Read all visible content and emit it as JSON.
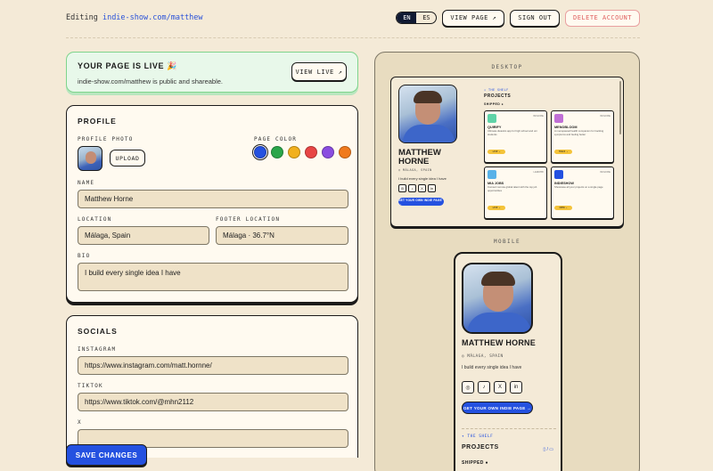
{
  "header": {
    "editing_prefix": "Editing",
    "editing_url": "indie-show.com/matthew",
    "lang_en": "EN",
    "lang_es": "ES",
    "view_page": "VIEW PAGE ↗",
    "sign_out": "SIGN OUT",
    "delete_account": "DELETE ACCOUNT"
  },
  "live": {
    "title": "YOUR PAGE IS LIVE 🎉",
    "subtitle": "indie-show.com/matthew is public and shareable.",
    "view_live": "VIEW LIVE ↗"
  },
  "profile": {
    "title": "PROFILE",
    "photo_label": "PROFILE PHOTO",
    "upload": "UPLOAD",
    "color_label": "PAGE COLOR",
    "colors": [
      "#2451e0",
      "#2aa64a",
      "#f1b01e",
      "#e84545",
      "#8a4de0",
      "#f07a1d"
    ],
    "selected_color": "#2451e0",
    "name_label": "NAME",
    "name_value": "Matthew Horne",
    "location_label": "LOCATION",
    "location_value": "Málaga, Spain",
    "footer_location_label": "FOOTER LOCATION",
    "footer_location_value": "Málaga · 36.7°N",
    "bio_label": "BIO",
    "bio_value": "I build every single idea I have"
  },
  "socials": {
    "title": "SOCIALS",
    "instagram_label": "INSTAGRAM",
    "instagram_value": "https://www.instagram.com/matt.hornne/",
    "tiktok_label": "TIKTOK",
    "tiktok_value": "https://www.tiktok.com/@mhn2112",
    "x_label": "X"
  },
  "save": "SAVE CHANGES",
  "preview": {
    "desktop_label": "DESKTOP",
    "mobile_label": "MOBILE",
    "name": "MATTHEW HORNE",
    "location": "◎ MÁLAGA, SPAIN",
    "bio": "I build every single idea I have",
    "cta": "GET YOUR OWN INDIE PAGE →",
    "shelf": "✦ THE SHELF",
    "projects": "PROJECTS",
    "projects_icons": "▯ / ▭",
    "shipped": "SHIPPED ●",
    "projects_list": [
      {
        "name": "QUIRIFY",
        "desc": "Ultimate dietetics app for high school and uni students",
        "tag": "LIVE ↗",
        "color": "#5fd3a8",
        "meta": "BUILDING"
      },
      {
        "name": "MENOBLOOM",
        "desc": "A menopausal health companion for tracking symptoms and feeling better",
        "tag": "TRACK ↗",
        "color": "#c06fd6",
        "meta": "BUILDING"
      },
      {
        "name": "MIA JOBS",
        "desc": "Connect remote global talent with the top job opportunities",
        "tag": "LIVE ↗",
        "color": "#59b2e8",
        "meta": "LAUNCHED"
      },
      {
        "name": "INDIESHOW",
        "desc": "Showcase all your projects on a single page",
        "tag": "OPEN ↗",
        "color": "#2451e0",
        "meta": "BUILDING"
      }
    ],
    "social_icons": [
      "◎",
      "♪",
      "X",
      "in"
    ]
  }
}
